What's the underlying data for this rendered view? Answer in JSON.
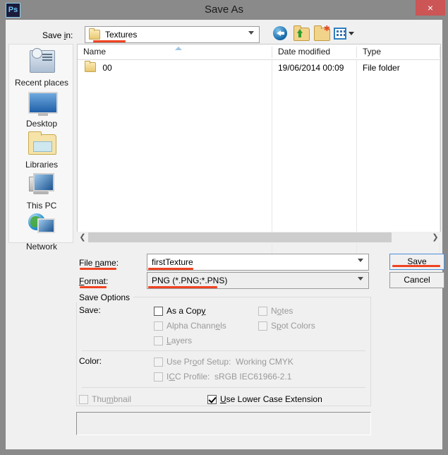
{
  "window": {
    "title": "Save As",
    "app_icon": "Ps",
    "close_label": "×"
  },
  "toolbar": {
    "savein_label": "Save in:",
    "savein_value": "Textures",
    "icons": [
      "back-icon",
      "up-folder-icon",
      "new-folder-icon",
      "views-icon"
    ]
  },
  "filelist": {
    "columns": [
      "Name",
      "Date modified",
      "Type"
    ],
    "rows": [
      {
        "name": "00",
        "date": "19/06/2014 00:09",
        "type": "File folder"
      }
    ],
    "scroll_left": "❮",
    "scroll_right": "❯"
  },
  "sidebar": {
    "items": [
      {
        "label": "Recent places",
        "icon": "recent-places-icon"
      },
      {
        "label": "Desktop",
        "icon": "desktop-icon"
      },
      {
        "label": "Libraries",
        "icon": "libraries-icon"
      },
      {
        "label": "This PC",
        "icon": "this-pc-icon"
      },
      {
        "label": "Network",
        "icon": "network-icon"
      }
    ]
  },
  "form": {
    "filename_label": "File name:",
    "filename_value": "firstTexture",
    "format_label": "Format:",
    "format_value": "PNG (*.PNG;*.PNS)",
    "save_button": "Save",
    "cancel_button": "Cancel"
  },
  "save_options": {
    "legend": "Save Options",
    "save_label": "Save:",
    "color_label": "Color:",
    "checkboxes": [
      {
        "label": "As a Copy",
        "checked": false,
        "disabled": false
      },
      {
        "label": "Notes",
        "checked": false,
        "disabled": true
      },
      {
        "label": "Alpha Channels",
        "checked": false,
        "disabled": true
      },
      {
        "label": "Spot Colors",
        "checked": false,
        "disabled": true
      },
      {
        "label": "Layers",
        "checked": false,
        "disabled": true
      },
      {
        "label": "Use Proof Setup:",
        "value": "Working CMYK",
        "checked": false,
        "disabled": true
      },
      {
        "label": "ICC Profile:",
        "value": "sRGB IEC61966-2.1",
        "checked": false,
        "disabled": true
      },
      {
        "label": "Thumbnail",
        "checked": false,
        "disabled": true
      },
      {
        "label": "Use Lower Case Extension",
        "checked": true,
        "disabled": false
      }
    ]
  },
  "colors": {
    "accent_red": "#ef4322",
    "close_red": "#cc5550",
    "titlebar_gray": "#8a8a8a",
    "dialog_gray": "#f0f0f0",
    "focus_blue": "#4a90d9"
  }
}
